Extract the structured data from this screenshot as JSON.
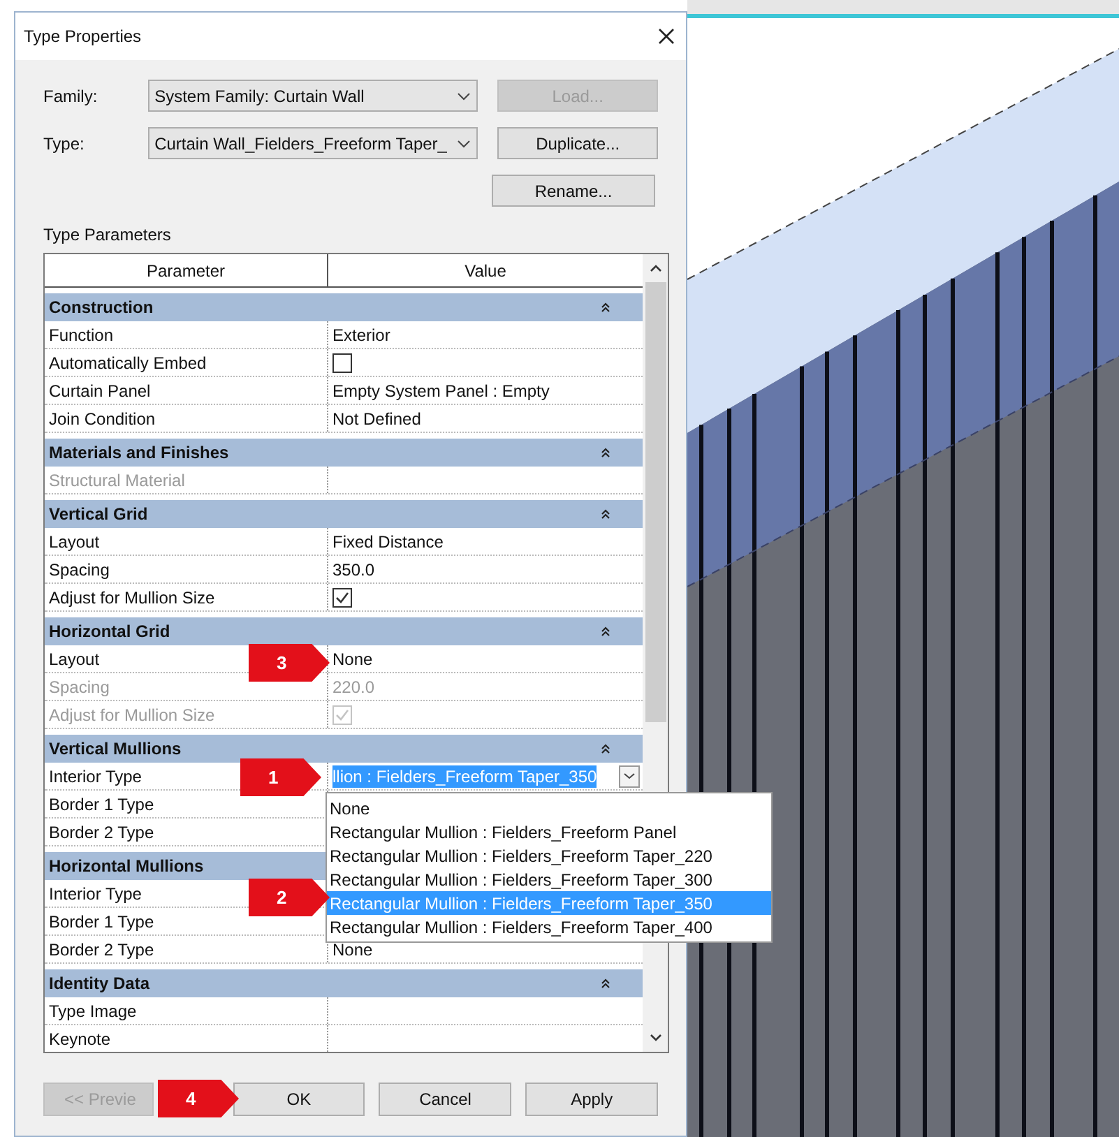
{
  "window": {
    "title": "Type Properties"
  },
  "family": {
    "label": "Family:",
    "value": "System Family: Curtain Wall"
  },
  "type": {
    "label": "Type:",
    "value": "Curtain Wall_Fielders_Freeform Taper_"
  },
  "side_buttons": [
    {
      "label": "Load...",
      "disabled": true
    },
    {
      "label": "Duplicate...",
      "disabled": false
    },
    {
      "label": "Rename...",
      "disabled": false
    }
  ],
  "type_parameters_label": "Type Parameters",
  "table": {
    "columns": [
      "Parameter",
      "Value"
    ],
    "sections": [
      {
        "title": "Construction",
        "rows": [
          {
            "parameter": "Function",
            "kind": "text",
            "value": "Exterior",
            "disabled": false
          },
          {
            "parameter": "Automatically Embed",
            "kind": "checkbox",
            "checked": false,
            "disabled": false
          },
          {
            "parameter": "Curtain Panel",
            "kind": "text",
            "value": "Empty System Panel : Empty",
            "disabled": false
          },
          {
            "parameter": "Join Condition",
            "kind": "text",
            "value": "Not Defined",
            "disabled": false
          }
        ]
      },
      {
        "title": "Materials and Finishes",
        "rows": [
          {
            "parameter": "Structural Material",
            "kind": "text",
            "disabled": true
          }
        ]
      },
      {
        "title": "Vertical Grid",
        "rows": [
          {
            "parameter": "Layout",
            "kind": "text",
            "value": "Fixed Distance",
            "disabled": false
          },
          {
            "parameter": "Spacing",
            "kind": "text",
            "value": "350.0",
            "disabled": false
          },
          {
            "parameter": "Adjust for Mullion Size",
            "kind": "checkbox",
            "checked": true,
            "disabled": false
          }
        ]
      },
      {
        "title": "Horizontal Grid",
        "rows": [
          {
            "parameter": "Layout",
            "kind": "text",
            "value": "None",
            "disabled": false
          },
          {
            "parameter": "Spacing",
            "kind": "text",
            "value": "220.0",
            "disabled": true
          },
          {
            "parameter": "Adjust for Mullion Size",
            "kind": "checkbox",
            "checked": true,
            "disabled": true
          }
        ]
      },
      {
        "title": "Vertical Mullions",
        "rows": [
          {
            "parameter": "Interior Type",
            "kind": "dropdown",
            "value": "llion : Fielders_Freeform Taper_350",
            "disabled": false
          },
          {
            "parameter": "Border 1 Type",
            "kind": "text",
            "disabled": false
          },
          {
            "parameter": "Border 2 Type",
            "kind": "text",
            "disabled": false
          }
        ]
      },
      {
        "title": "Horizontal Mullions",
        "rows": [
          {
            "parameter": "Interior Type",
            "kind": "text",
            "disabled": false
          },
          {
            "parameter": "Border 1 Type",
            "kind": "text",
            "disabled": false
          },
          {
            "parameter": "Border 2 Type",
            "kind": "text",
            "value": "None",
            "disabled": false
          }
        ]
      },
      {
        "title": "Identity Data",
        "rows": [
          {
            "parameter": "Type Image",
            "kind": "text",
            "disabled": false
          },
          {
            "parameter": "Keynote",
            "kind": "text",
            "disabled": false
          }
        ]
      }
    ]
  },
  "dropdown_list": {
    "options": [
      {
        "label": "None",
        "selected": false
      },
      {
        "label": "Rectangular Mullion : Fielders_Freeform Panel",
        "selected": false
      },
      {
        "label": "Rectangular Mullion : Fielders_Freeform Taper_220",
        "selected": false
      },
      {
        "label": "Rectangular Mullion : Fielders_Freeform Taper_300",
        "selected": false
      },
      {
        "label": "Rectangular Mullion : Fielders_Freeform Taper_350",
        "selected": true
      },
      {
        "label": "Rectangular Mullion : Fielders_Freeform Taper_400",
        "selected": false
      }
    ]
  },
  "callouts": [
    {
      "number": "3"
    },
    {
      "number": "1"
    },
    {
      "number": "2"
    },
    {
      "number": "4"
    }
  ],
  "footer_buttons": [
    {
      "label": "<< Previe",
      "disabled": true
    },
    {
      "label": "OK",
      "disabled": false
    },
    {
      "label": "Cancel",
      "disabled": false
    },
    {
      "label": "Apply",
      "disabled": false
    }
  ]
}
